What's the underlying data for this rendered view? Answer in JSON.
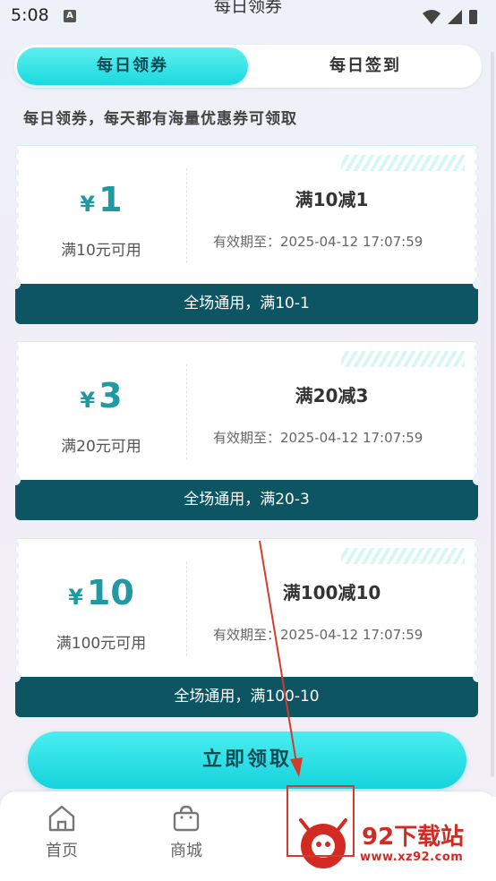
{
  "status_bar": {
    "time": "5:08",
    "notification_icon": "A"
  },
  "header": {
    "title": "每日领券"
  },
  "tabs": [
    {
      "label": "每日领券",
      "active": true
    },
    {
      "label": "每日签到",
      "active": false
    }
  ],
  "subtitle": "每日领券，每天都有海量优惠券可领取",
  "coupons": [
    {
      "currency": "¥",
      "amount": "1",
      "condition": "满10元可用",
      "title": "满10减1",
      "expiry": "有效期至：2025-04-12 17:07:59",
      "banner": "全场通用，满10-1"
    },
    {
      "currency": "¥",
      "amount": "3",
      "condition": "满20元可用",
      "title": "满20减3",
      "expiry": "有效期至：2025-04-12 17:07:59",
      "banner": "全场通用，满20-3"
    },
    {
      "currency": "¥",
      "amount": "10",
      "condition": "满100元可用",
      "title": "满100减10",
      "expiry": "有效期至：2025-04-12 17:07:59",
      "banner": "全场通用，满100-10"
    }
  ],
  "claim_button": "立即领取",
  "bottom_nav": [
    {
      "label": "首页",
      "icon": "home-icon"
    },
    {
      "label": "商城",
      "icon": "shopping-bag-icon"
    }
  ],
  "watermark": {
    "name": "92下载站",
    "url": "www.xz92.com"
  },
  "colors": {
    "accent": "#19d9e0",
    "banner": "#0d5563",
    "amount": "#1f9aa2",
    "annotation": "#d33b2c"
  }
}
